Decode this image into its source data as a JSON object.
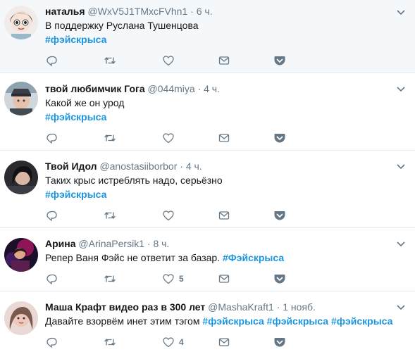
{
  "colors": {
    "hashtag": "#1b95e0",
    "secondary": "#657786",
    "divider": "#e6ecf0",
    "highlight": "#f5f8fa"
  },
  "tweets": [
    {
      "name": "наталья",
      "screen_name": "@WxV5J1TMxcFVhn1",
      "dot": "·",
      "time": "6 ч.",
      "line1": "В поддержку Руслана Тушенцова",
      "hashtags": [
        "#фэйскрыса"
      ],
      "like_count": ""
    },
    {
      "name": "твой любимчик Гога",
      "screen_name": "@044miya",
      "dot": "·",
      "time": "4 ч.",
      "line1": "Какой же он урод",
      "hashtags": [
        "#фэйскрыса"
      ],
      "like_count": ""
    },
    {
      "name": "Твой Идол",
      "screen_name": "@anostasiiborbor",
      "dot": "·",
      "time": "4 ч.",
      "line1": "Таких крыс истреблять надо, серьёзно",
      "hashtags": [
        "#фэйскрыса"
      ],
      "like_count": ""
    },
    {
      "name": "Арина",
      "screen_name": "@ArinaPersik1",
      "dot": "·",
      "time": "8 ч.",
      "line1": "Репер Ваня Фэйс не ответит за базар.",
      "hashtags": [
        "#Фэйскрыса"
      ],
      "like_count": "5"
    },
    {
      "name": "Маша Крафт видео раз в 300 лет",
      "screen_name": "@MashaKraft1",
      "dot": "·",
      "time": "1 нояб.",
      "line1": "Давайте взорвём инет этим тэгом",
      "hashtags": [
        "#фэйскрыса",
        "#фэйскрыса",
        "#фэйскрыса"
      ],
      "like_count": "4"
    }
  ],
  "icons": {
    "reply": "reply-icon",
    "retweet": "retweet-icon",
    "like": "heart-icon",
    "dm": "envelope-icon",
    "save": "pocket-save-icon",
    "caret": "chevron-down-icon"
  }
}
